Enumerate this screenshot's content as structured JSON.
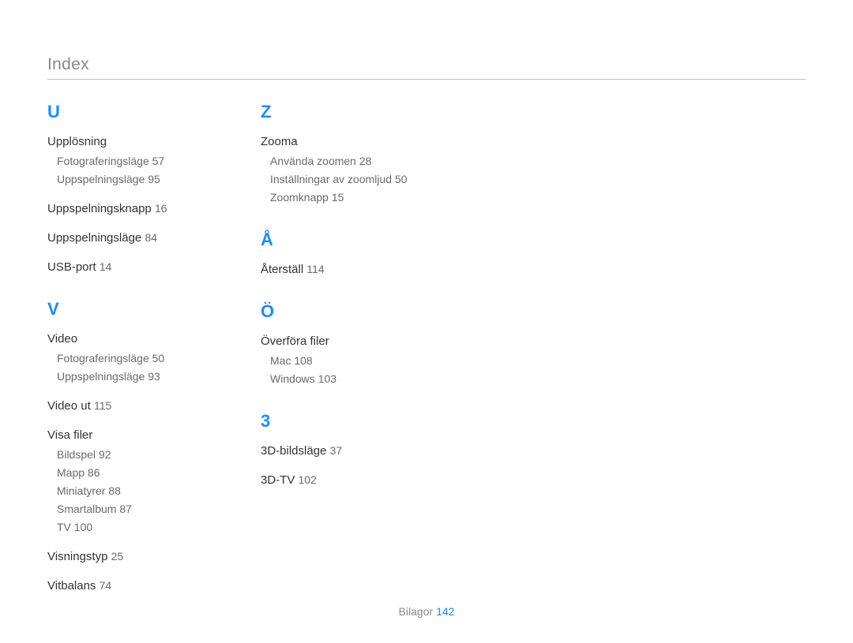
{
  "title": "Index",
  "footer": {
    "label": "Bilagor",
    "page": "142"
  },
  "columns": [
    [
      {
        "letter": "U",
        "entries": [
          {
            "topic": "Upplösning",
            "subitems": [
              {
                "label": "Fotograferingsläge",
                "page": "57"
              },
              {
                "label": "Uppspelningsläge",
                "page": "95"
              }
            ]
          },
          {
            "topic": "Uppspelningsknapp",
            "page": "16"
          },
          {
            "topic": "Uppspelningsläge",
            "page": "84"
          },
          {
            "topic": "USB-port",
            "page": "14"
          }
        ]
      },
      {
        "letter": "V",
        "entries": [
          {
            "topic": "Video",
            "subitems": [
              {
                "label": "Fotograferingsläge",
                "page": "50"
              },
              {
                "label": "Uppspelningsläge",
                "page": "93"
              }
            ]
          },
          {
            "topic": "Video ut",
            "page": "115"
          },
          {
            "topic": "Visa filer",
            "subitems": [
              {
                "label": "Bildspel",
                "page": "92"
              },
              {
                "label": "Mapp",
                "page": "86"
              },
              {
                "label": "Miniatyrer",
                "page": "88"
              },
              {
                "label": "Smartalbum",
                "page": "87"
              },
              {
                "label": "TV",
                "page": "100"
              }
            ]
          },
          {
            "topic": "Visningstyp",
            "page": "25"
          },
          {
            "topic": "Vitbalans",
            "page": "74"
          }
        ]
      }
    ],
    [
      {
        "letter": "Z",
        "entries": [
          {
            "topic": "Zooma",
            "subitems": [
              {
                "label": "Använda zoomen",
                "page": "28"
              },
              {
                "label": "Inställningar av zoomljud",
                "page": "50"
              },
              {
                "label": "Zoomknapp",
                "page": "15"
              }
            ]
          }
        ]
      },
      {
        "letter": "Å",
        "entries": [
          {
            "topic": "Återställ",
            "page": "114"
          }
        ]
      },
      {
        "letter": "Ö",
        "entries": [
          {
            "topic": "Överföra filer",
            "subitems": [
              {
                "label": "Mac",
                "page": "108"
              },
              {
                "label": "Windows",
                "page": "103"
              }
            ]
          }
        ]
      },
      {
        "letter": "3",
        "entries": [
          {
            "topic": "3D-bildsläge",
            "page": "37"
          },
          {
            "topic": "3D-TV",
            "page": "102"
          }
        ]
      }
    ]
  ]
}
